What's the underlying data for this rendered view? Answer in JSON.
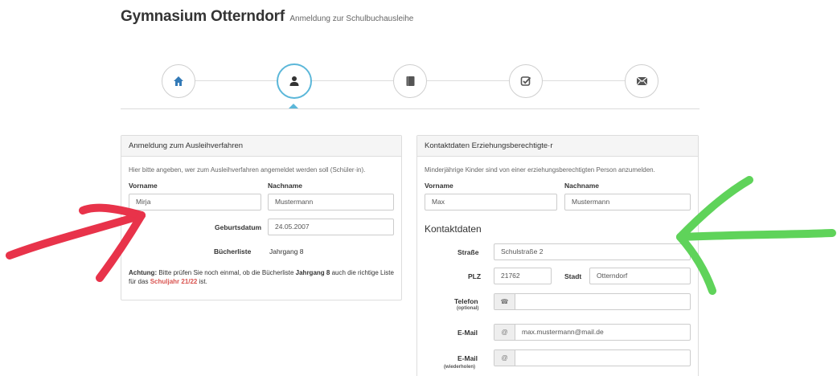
{
  "header": {
    "title": "Gymnasium Otterndorf",
    "subtitle": "Anmeldung zur Schulbuchausleihe"
  },
  "wizard": {
    "steps": [
      {
        "icon": "home-icon",
        "color": "#337ab7"
      },
      {
        "icon": "user-icon",
        "color": "#333333",
        "active": true
      },
      {
        "icon": "book-icon",
        "color": "#555555"
      },
      {
        "icon": "check-square-icon",
        "color": "#555555"
      },
      {
        "icon": "envelope-icon",
        "color": "#555555"
      }
    ],
    "active_color": "#5bb7d9"
  },
  "left_panel": {
    "heading": "Anmeldung zum Ausleihverfahren",
    "help": "Hier bitte angeben, wer zum Ausleihverfahren angemeldet werden soll (Schüler·in).",
    "vorname_label": "Vorname",
    "nachname_label": "Nachname",
    "vorname_value": "Mirja",
    "nachname_value": "Mustermann",
    "geburtsdatum_label": "Geburtsdatum",
    "geburtsdatum_value": "24.05.2007",
    "buecherliste_label": "Bücherliste",
    "buecherliste_value": "Jahrgang 8",
    "warning": {
      "t1": "Achtung:",
      "t2": " Bitte prüfen Sie noch einmal, ob die Bücherliste ",
      "t3": "Jahrgang 8",
      "t4": " auch die richtige Liste für das ",
      "t5": "Schuljahr 21/22",
      "t6": " ist."
    }
  },
  "right_panel": {
    "heading": "Kontaktdaten Erziehungsberechtigte·r",
    "help": "Minderjährige Kinder sind von einer erziehungsberechtigten Person anzumelden.",
    "vorname_label": "Vorname",
    "nachname_label": "Nachname",
    "vorname_value": "Max",
    "nachname_value": "Mustermann",
    "kontakt_title": "Kontaktdaten",
    "strasse_label": "Straße",
    "strasse_value": "Schulstraße 2",
    "plz_label": "PLZ",
    "plz_value": "21762",
    "stadt_label": "Stadt",
    "stadt_value": "Otterndorf",
    "telefon_label": "Telefon",
    "telefon_sub": "(optional)",
    "telefon_value": "",
    "email_label": "E-Mail",
    "email_value": "max.mustermann@mail.de",
    "email2_label": "E-Mail",
    "email2_sub": "(wiederholen)",
    "email2_value": ""
  },
  "annotations": {
    "red_arrow_color": "#e8334a",
    "green_arrow_color": "#5fd35a"
  }
}
